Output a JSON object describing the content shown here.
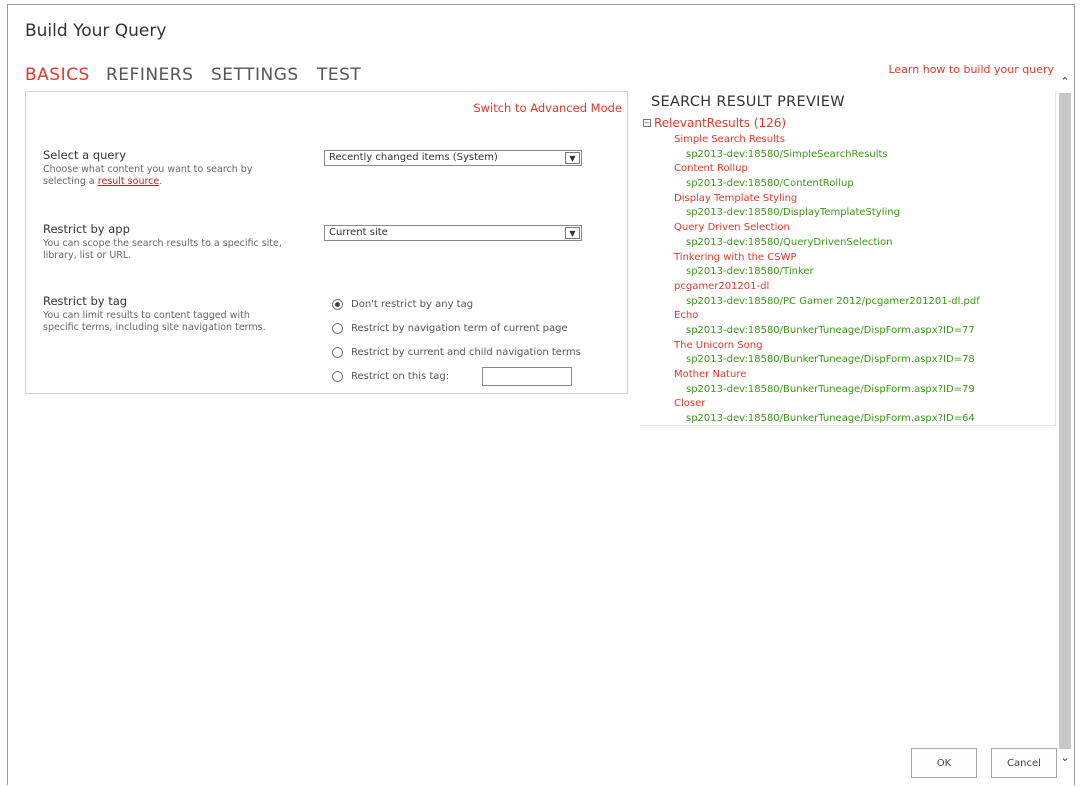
{
  "dialog": {
    "title": "Build Your Query"
  },
  "tabs": [
    {
      "label": "BASICS"
    },
    {
      "label": "REFINERS"
    },
    {
      "label": "SETTINGS"
    },
    {
      "label": "TEST"
    }
  ],
  "links": {
    "learn": "Learn how to build your query",
    "advanced": "Switch to Advanced Mode"
  },
  "query": {
    "title": "Select a query",
    "desc_prefix": "Choose what content you want to search by selecting a ",
    "desc_link": "result source",
    "desc_suffix": ".",
    "value": "Recently changed items (System)"
  },
  "app": {
    "title": "Restrict by app",
    "desc": "You can scope the search results to a specific site, library, list or URL.",
    "value": "Current site"
  },
  "tag": {
    "title": "Restrict by tag",
    "desc": "You can limit results to content tagged with specific terms, including site navigation terms.",
    "options": [
      "Don't restrict by any tag",
      "Restrict by navigation term of current page",
      "Restrict by current and child navigation terms",
      "Restrict on this tag:"
    ]
  },
  "preview": {
    "title": "SEARCH RESULT PREVIEW",
    "group": "RelevantResults (126)",
    "results": [
      {
        "title": "Simple Search Results",
        "url": "sp2013-dev:18580/SimpleSearchResults"
      },
      {
        "title": "Content Rollup",
        "url": "sp2013-dev:18580/ContentRollup"
      },
      {
        "title": "Display Template Styling",
        "url": "sp2013-dev:18580/DisplayTemplateStyling"
      },
      {
        "title": "Query Driven Selection",
        "url": "sp2013-dev:18580/QueryDrivenSelection"
      },
      {
        "title": "Tinkering with the CSWP",
        "url": "sp2013-dev:18580/Tinker"
      },
      {
        "title": "pcgamer201201-dl",
        "url": "sp2013-dev:18580/PC Gamer 2012/pcgamer201201-dl.pdf"
      },
      {
        "title": "Echo",
        "url": "sp2013-dev:18580/BunkerTuneage/DispForm.aspx?ID=77"
      },
      {
        "title": "The Unicorn Song",
        "url": "sp2013-dev:18580/BunkerTuneage/DispForm.aspx?ID=78"
      },
      {
        "title": "Mother Nature",
        "url": "sp2013-dev:18580/BunkerTuneage/DispForm.aspx?ID=79"
      },
      {
        "title": "Closer",
        "url": "sp2013-dev:18580/BunkerTuneage/DispForm.aspx?ID=64"
      }
    ]
  },
  "buttons": {
    "ok": "OK",
    "cancel": "Cancel"
  },
  "icons": {
    "collapse": "minus-box-icon",
    "dropdown": "chevron-down-icon"
  },
  "colors": {
    "accent": "#e13a2b",
    "url": "#3a9a16"
  }
}
